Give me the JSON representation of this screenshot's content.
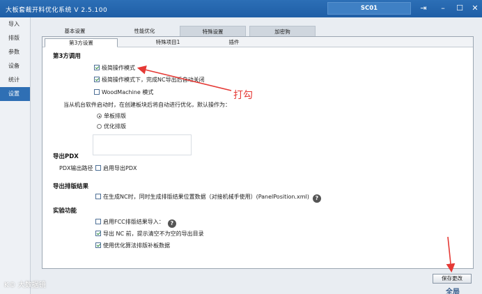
{
  "titlebar": {
    "title": "大板套裁开料优化系统  V 2.5.100",
    "station": "SC01"
  },
  "sidebar": {
    "items": [
      {
        "label": "导入"
      },
      {
        "label": "排版"
      },
      {
        "label": "参数"
      },
      {
        "label": "设备"
      },
      {
        "label": "统计"
      },
      {
        "label": "设置"
      }
    ]
  },
  "tabs_top": [
    {
      "label": "基本设置"
    },
    {
      "label": "性能优化"
    },
    {
      "label": "特殊设置"
    },
    {
      "label": "加密狗"
    }
  ],
  "tabs_sub": [
    {
      "label": "第3方设置"
    },
    {
      "label": "特殊项目1"
    },
    {
      "label": "插件"
    }
  ],
  "sections": {
    "third_party": {
      "title": "第3方调用",
      "opt1": "极简操作模式",
      "opt2": "极简操作模式下，完成NC导出后自动关闭",
      "opt3": "WoodMachine 模式",
      "prompt": "当从机台软件启动时，在创建板块后将自动进行优化，默认操作为：",
      "radio1": "单板排版",
      "radio2": "优化排版"
    },
    "pdx": {
      "title": "导出PDX",
      "path_label": "PDX输出路径",
      "enable": "启用导出PDX"
    },
    "layout_result": {
      "title": "导出排版结果",
      "opt": "在生成NC时，同时生成排版结果位置数据（对接机械手使用）(PanelPosition.xml)"
    },
    "experimental": {
      "title": "实验功能",
      "opt1": "启用FCC排版结果导入：",
      "opt2": "导出 NC 前，提示清空不为空的导出目录",
      "opt3": "使用优化算法排版补板数据"
    }
  },
  "save_button": "保存更改",
  "annotation": "打勾",
  "watermark": "K© 大数据镜",
  "corner_logo": "全局",
  "colors": {
    "titlebar": "#2c6fb6",
    "active_side": "#2f6fb4",
    "annotation": "#e53935"
  }
}
